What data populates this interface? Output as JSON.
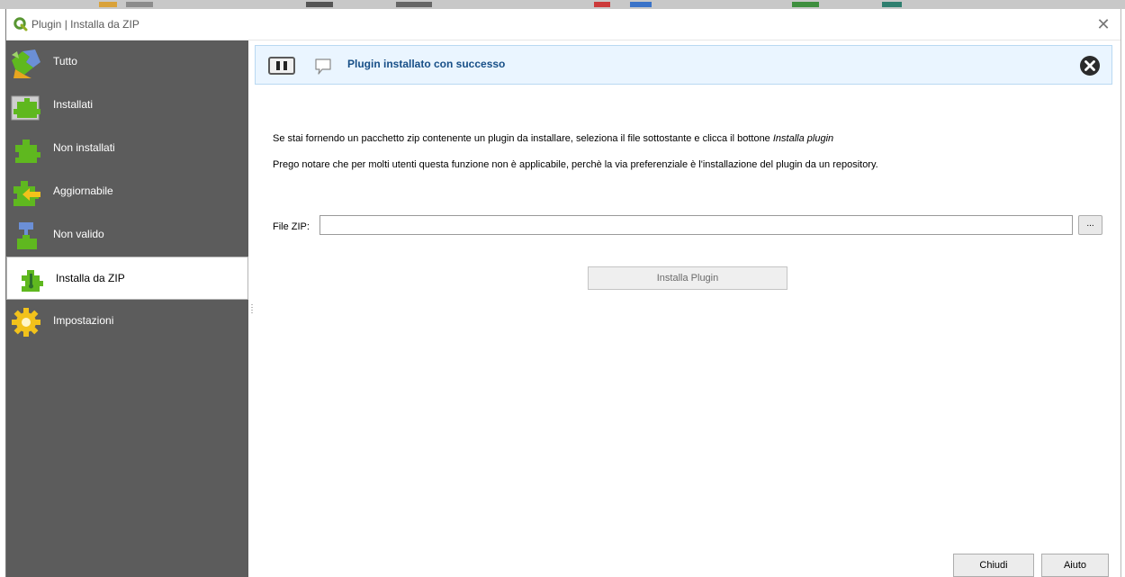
{
  "window": {
    "title": "Plugin | Installa da ZIP",
    "close_symbol": "✕"
  },
  "sidebar": {
    "items": [
      {
        "label": "Tutto",
        "icon": "puzzle-all-icon"
      },
      {
        "label": "Installati",
        "icon": "puzzle-installed-icon"
      },
      {
        "label": "Non installati",
        "icon": "puzzle-green-icon"
      },
      {
        "label": "Aggiornabile",
        "icon": "puzzle-upgrade-icon"
      },
      {
        "label": "Non valido",
        "icon": "puzzle-invalid-icon"
      },
      {
        "label": "Installa da ZIP",
        "icon": "puzzle-zip-icon"
      },
      {
        "label": "Impostazioni",
        "icon": "gear-icon"
      }
    ],
    "active_index": 5
  },
  "message_bar": {
    "text": "Plugin installato con successo"
  },
  "content": {
    "description_prefix": "Se stai fornendo un pacchetto zip contenente un plugin da installare, seleziona il file sottostante e clicca il bottone ",
    "description_emphasis": "Installa plugin",
    "note": "Prego notare che per molti utenti questa funzione non è applicabile, perchè la via preferenziale è l'installazione del plugin da un repository.",
    "zip_label": "File ZIP:",
    "zip_value": "",
    "browse_label": "...",
    "install_button": "Installa Plugin"
  },
  "footer": {
    "close_button": "Chiudi",
    "help_button": "Aiuto"
  },
  "colors": {
    "sidebar_bg": "#5c5c5c",
    "message_bg": "#eaf5ff",
    "message_text": "#174f87",
    "puzzle_green": "#5fb81f"
  }
}
